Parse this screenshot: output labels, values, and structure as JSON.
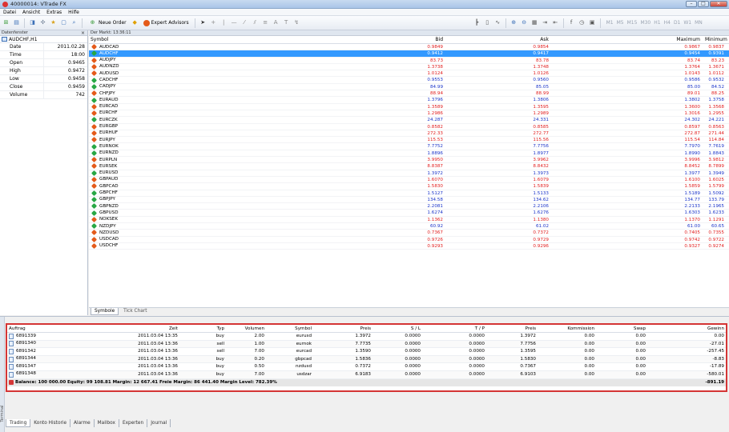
{
  "window": {
    "title": "40000014: VTrade FX"
  },
  "menu": [
    "Datei",
    "Ansicht",
    "Extras",
    "Hilfe"
  ],
  "toolbar": {
    "new_order": "Neue Order",
    "expert_advisors": "Expert Advisors",
    "timeframes": [
      "M1",
      "M5",
      "M15",
      "M30",
      "H1",
      "H4",
      "D1",
      "W1",
      "MN"
    ]
  },
  "data_window": {
    "header": "Datenfenster",
    "symbol": "AUDCHF,H1",
    "rows": [
      {
        "key": "Date",
        "value": "2011.02.28"
      },
      {
        "key": "Time",
        "value": "18:00"
      },
      {
        "key": "Open",
        "value": "0.9465"
      },
      {
        "key": "High",
        "value": "0.9472"
      },
      {
        "key": "Low",
        "value": "0.9458"
      },
      {
        "key": "Close",
        "value": "0.9459"
      },
      {
        "key": "Volume",
        "value": "742"
      }
    ]
  },
  "market_watch": {
    "header": "Der Markt: 13:36:11",
    "columns": {
      "symbol": "Symbol",
      "bid": "Bid",
      "ask": "Ask",
      "max": "Maximum",
      "min": "Minimum"
    },
    "rows": [
      {
        "s": "AUDCAD",
        "bid": "0.9849",
        "ask": "0.9854",
        "max": "0.9867",
        "min": "0.9837",
        "dir": "down",
        "c": "red"
      },
      {
        "s": "AUDCHF",
        "bid": "0.9412",
        "ask": "0.9417",
        "max": "0.9454",
        "min": "0.9391",
        "dir": "up",
        "c": "blue",
        "sel": true
      },
      {
        "s": "AUDJPY",
        "bid": "83.73",
        "ask": "83.78",
        "max": "83.74",
        "min": "83.23",
        "dir": "down",
        "c": "red"
      },
      {
        "s": "AUDNZD",
        "bid": "1.3738",
        "ask": "1.3748",
        "max": "1.3764",
        "min": "1.3671",
        "dir": "down",
        "c": "red"
      },
      {
        "s": "AUDUSD",
        "bid": "1.0124",
        "ask": "1.0126",
        "max": "1.0143",
        "min": "1.0112",
        "dir": "down",
        "c": "red"
      },
      {
        "s": "CADCHF",
        "bid": "0.9553",
        "ask": "0.9560",
        "max": "0.9586",
        "min": "0.9532",
        "dir": "up",
        "c": "blue"
      },
      {
        "s": "CADJPY",
        "bid": "84.99",
        "ask": "85.05",
        "max": "85.00",
        "min": "84.52",
        "dir": "up",
        "c": "blue"
      },
      {
        "s": "CHFJPY",
        "bid": "88.94",
        "ask": "88.99",
        "max": "89.01",
        "min": "88.25",
        "dir": "down",
        "c": "red"
      },
      {
        "s": "EURAUD",
        "bid": "1.3796",
        "ask": "1.3806",
        "max": "1.3802",
        "min": "1.3758",
        "dir": "up",
        "c": "blue"
      },
      {
        "s": "EURCAD",
        "bid": "1.3589",
        "ask": "1.3595",
        "max": "1.3600",
        "min": "1.3568",
        "dir": "down",
        "c": "red"
      },
      {
        "s": "EURCHF",
        "bid": "1.2986",
        "ask": "1.2989",
        "max": "1.3016",
        "min": "1.2955",
        "dir": "down",
        "c": "red"
      },
      {
        "s": "EURCZK",
        "bid": "24.287",
        "ask": "24.331",
        "max": "24.302",
        "min": "24.221",
        "dir": "up",
        "c": "blue"
      },
      {
        "s": "EURGBP",
        "bid": "0.8582",
        "ask": "0.8585",
        "max": "0.8597",
        "min": "0.8563",
        "dir": "down",
        "c": "red"
      },
      {
        "s": "EURHUF",
        "bid": "272.33",
        "ask": "272.77",
        "max": "272.87",
        "min": "271.44",
        "dir": "down",
        "c": "red"
      },
      {
        "s": "EURJPY",
        "bid": "115.53",
        "ask": "115.56",
        "max": "115.54",
        "min": "114.84",
        "dir": "down",
        "c": "red"
      },
      {
        "s": "EURNOK",
        "bid": "7.7752",
        "ask": "7.7756",
        "max": "7.7970",
        "min": "7.7619",
        "dir": "up",
        "c": "blue"
      },
      {
        "s": "EURNZD",
        "bid": "1.8896",
        "ask": "1.8977",
        "max": "1.8990",
        "min": "1.8843",
        "dir": "up",
        "c": "blue"
      },
      {
        "s": "EURPLN",
        "bid": "3.9950",
        "ask": "3.9962",
        "max": "3.9996",
        "min": "3.9812",
        "dir": "down",
        "c": "red"
      },
      {
        "s": "EURSEK",
        "bid": "8.8387",
        "ask": "8.8432",
        "max": "8.8452",
        "min": "8.7899",
        "dir": "down",
        "c": "red"
      },
      {
        "s": "EURUSD",
        "bid": "1.3972",
        "ask": "1.3973",
        "max": "1.3977",
        "min": "1.3949",
        "dir": "up",
        "c": "blue"
      },
      {
        "s": "GBPAUD",
        "bid": "1.6070",
        "ask": "1.6079",
        "max": "1.6100",
        "min": "1.6025",
        "dir": "down",
        "c": "red"
      },
      {
        "s": "GBPCAD",
        "bid": "1.5830",
        "ask": "1.5839",
        "max": "1.5859",
        "min": "1.5799",
        "dir": "down",
        "c": "red"
      },
      {
        "s": "GBPCHF",
        "bid": "1.5127",
        "ask": "1.5133",
        "max": "1.5189",
        "min": "1.5092",
        "dir": "up",
        "c": "blue"
      },
      {
        "s": "GBPJPY",
        "bid": "134.58",
        "ask": "134.62",
        "max": "134.77",
        "min": "133.79",
        "dir": "up",
        "c": "blue"
      },
      {
        "s": "GBPNZD",
        "bid": "2.2081",
        "ask": "2.2106",
        "max": "2.2133",
        "min": "2.1965",
        "dir": "up",
        "c": "blue"
      },
      {
        "s": "GBPUSD",
        "bid": "1.6274",
        "ask": "1.6276",
        "max": "1.6303",
        "min": "1.6233",
        "dir": "up",
        "c": "blue"
      },
      {
        "s": "NOKSEK",
        "bid": "1.1362",
        "ask": "1.1380",
        "max": "1.1370",
        "min": "1.1291",
        "dir": "down",
        "c": "red"
      },
      {
        "s": "NZDJPY",
        "bid": "60.92",
        "ask": "61.02",
        "max": "61.00",
        "min": "60.65",
        "dir": "up",
        "c": "blue"
      },
      {
        "s": "NZDUSD",
        "bid": "0.7367",
        "ask": "0.7372",
        "max": "0.7405",
        "min": "0.7355",
        "dir": "down",
        "c": "red"
      },
      {
        "s": "USDCAD",
        "bid": "0.9726",
        "ask": "0.9729",
        "max": "0.9742",
        "min": "0.9722",
        "dir": "down",
        "c": "red"
      },
      {
        "s": "USDCHF",
        "bid": "0.9293",
        "ask": "0.9296",
        "max": "0.9327",
        "min": "0.9274",
        "dir": "down",
        "c": "red"
      }
    ],
    "tabs": [
      "Symbole",
      "Tick Chart"
    ]
  },
  "terminal": {
    "side_label": "Terminal",
    "columns": {
      "order": "Auftrag",
      "time": "Zeit",
      "type": "Typ",
      "volume": "Volumen",
      "symbol": "Symbol",
      "price": "Preis",
      "sl": "S / L",
      "tp": "T / P",
      "price2": "Preis",
      "commission": "Kommission",
      "swap": "Swap",
      "profit": "Gewinn"
    },
    "rows": [
      {
        "order": "6891339",
        "time": "2011.03.04 13:35",
        "type": "buy",
        "volume": "2.00",
        "symbol": "eurusd",
        "price": "1.3972",
        "sl": "0.0000",
        "tp": "0.0000",
        "price2": "1.3972",
        "commission": "0.00",
        "swap": "0.00",
        "profit": "0.00"
      },
      {
        "order": "6891340",
        "time": "2011.03.04 13:36",
        "type": "sell",
        "volume": "1.00",
        "symbol": "eurnok",
        "price": "7.7735",
        "sl": "0.0000",
        "tp": "0.0000",
        "price2": "7.7756",
        "commission": "0.00",
        "swap": "0.00",
        "profit": "-27.01"
      },
      {
        "order": "6891342",
        "time": "2011.03.04 13:36",
        "type": "sell",
        "volume": "7.00",
        "symbol": "eurcad",
        "price": "1.3590",
        "sl": "0.0000",
        "tp": "0.0000",
        "price2": "1.3595",
        "commission": "0.00",
        "swap": "0.00",
        "profit": "-257.45"
      },
      {
        "order": "6891344",
        "time": "2011.03.04 13:36",
        "type": "buy",
        "volume": "0.20",
        "symbol": "gbpcad",
        "price": "1.5836",
        "sl": "0.0000",
        "tp": "0.0000",
        "price2": "1.5830",
        "commission": "0.00",
        "swap": "0.00",
        "profit": "-8.83"
      },
      {
        "order": "6891347",
        "time": "2011.03.04 13:36",
        "type": "buy",
        "volume": "0.50",
        "symbol": "nzdusd",
        "price": "0.7372",
        "sl": "0.0000",
        "tp": "0.0000",
        "price2": "0.7367",
        "commission": "0.00",
        "swap": "0.00",
        "profit": "-17.89"
      },
      {
        "order": "6891348",
        "time": "2011.03.04 13:36",
        "type": "buy",
        "volume": "7.00",
        "symbol": "usdzar",
        "price": "6.9183",
        "sl": "0.0000",
        "tp": "0.0000",
        "price2": "6.9103",
        "commission": "0.00",
        "swap": "0.00",
        "profit": "-580.01"
      }
    ],
    "balance_text": "Balance: 100 000.00  Equity: 99 108.81  Margin: 12 667.41  Freie Margin: 86 441.40  Margin Level: 782.39%",
    "balance_total": "-891.19",
    "tabs": [
      "Trading",
      "Konto Historie",
      "Alarme",
      "Mailbox",
      "Experten",
      "Journal"
    ]
  },
  "colors": {
    "selection": "#3399ff",
    "up": "#28a745",
    "down": "#e45a1a",
    "blue_price": "#1b35c9",
    "red_price": "#e11d1d",
    "highlight_border": "#d43535"
  }
}
